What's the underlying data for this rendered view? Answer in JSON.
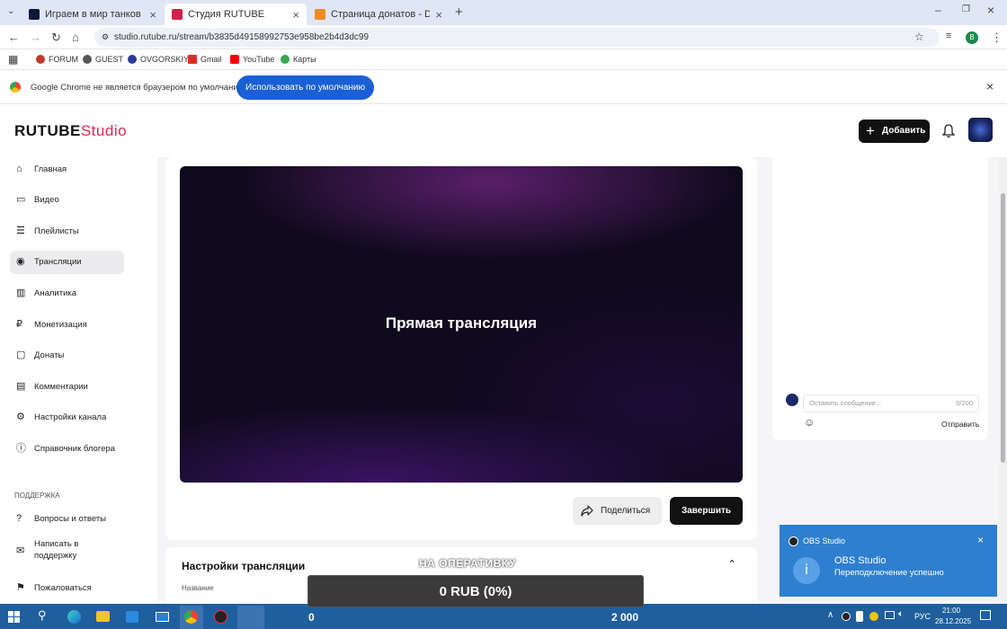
{
  "browser": {
    "tabs": [
      {
        "title": "Играем в мир танков сборочк",
        "active": false
      },
      {
        "title": "Студия RUTUBE",
        "active": true
      },
      {
        "title": "Страница донатов - Donation",
        "active": false
      }
    ],
    "url": "studio.rutube.ru/stream/b3835d49158992753e958be2b4d3dc99",
    "bookmarks": [
      "FORUM",
      "GUEST",
      "OVGORSKIY",
      "Gmail",
      "YouTube",
      "Карты"
    ],
    "profile_letter": "B",
    "infobar_text": "Google Chrome не является браузером по умолчанию.",
    "infobar_button": "Использовать по умолчанию"
  },
  "header": {
    "logo_main": "RUTUBE",
    "logo_suffix": "Studio",
    "add_button": "Добавить"
  },
  "sidebar": {
    "items": [
      {
        "label": "Главная",
        "icon": "home-icon",
        "active": false
      },
      {
        "label": "Видео",
        "icon": "video-icon",
        "active": false
      },
      {
        "label": "Плейлисты",
        "icon": "playlist-icon",
        "active": false
      },
      {
        "label": "Трансляции",
        "icon": "broadcast-icon",
        "active": true
      },
      {
        "label": "Аналитика",
        "icon": "analytics-icon",
        "active": false
      },
      {
        "label": "Монетизация",
        "icon": "monetization-icon",
        "active": false
      },
      {
        "label": "Донаты",
        "icon": "donation-icon",
        "active": false
      },
      {
        "label": "Комментарии",
        "icon": "comments-icon",
        "active": false
      },
      {
        "label": "Настройки канала",
        "icon": "settings-icon",
        "active": false
      },
      {
        "label": "Справочник блогера",
        "icon": "info-icon",
        "active": false
      }
    ],
    "support_heading": "ПОДДЕРЖКА",
    "support_items": [
      {
        "label": "Вопросы и ответы",
        "icon": "question-icon"
      },
      {
        "label": "Написать в поддержку",
        "icon": "mail-icon"
      },
      {
        "label": "Пожаловаться",
        "icon": "flag-icon"
      }
    ]
  },
  "player": {
    "title": "Прямая трансляция"
  },
  "actions": {
    "share": "Поделиться",
    "end": "Завершить"
  },
  "settings": {
    "title": "Настройки трансляции",
    "field_label": "Название"
  },
  "chat": {
    "placeholder": "Оставить сообщение...",
    "counter": "0/200",
    "send": "Отправить"
  },
  "overlay": {
    "caption": "НА ОПЕРАТИВКУ",
    "amount": "0 RUB (0%)",
    "left_value": "0",
    "right_value": "2 000"
  },
  "toast": {
    "app": "OBS Studio",
    "title": "OBS Studio",
    "message": "Переподключение успешно"
  },
  "taskbar": {
    "lang": "РУС",
    "time": "21:00",
    "date": "28.12.2025"
  },
  "colors": {
    "accent": "#1a5fd6",
    "brand_red": "#e6254e",
    "toast": "#2f7fd0",
    "taskbar": "#1f5f9e"
  }
}
